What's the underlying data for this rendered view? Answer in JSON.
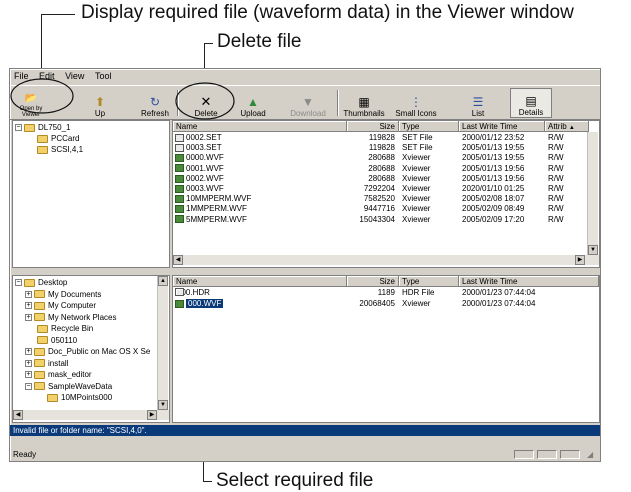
{
  "annotations": {
    "display": "Display required file (waveform data) in the Viewer window",
    "delete": "Delete file",
    "select": "Select required file"
  },
  "menu": [
    "File",
    "Edit",
    "View",
    "Tool"
  ],
  "toolbar": {
    "open_by_viewer": "Open by Viewer",
    "up": "Up",
    "refresh": "Refresh",
    "delete": "Delete",
    "upload": "Upload",
    "download": "Download",
    "thumbnails": "Thumbnails",
    "small_icons": "Small Icons",
    "list": "List",
    "details": "Details"
  },
  "top_tree": [
    {
      "label": "DL750_1",
      "expander": "−"
    },
    {
      "label": "PCCard"
    },
    {
      "label": "SCSI,4,1"
    }
  ],
  "top_columns": [
    "Name",
    "Size",
    "Type",
    "Last Write Time",
    "Attrib"
  ],
  "top_files": [
    {
      "name": "0002.SET",
      "size": "119828",
      "type": "SET File",
      "time": "2000/01/12 23:52",
      "attrib": "R/W",
      "icon": "set"
    },
    {
      "name": "0003.SET",
      "size": "119828",
      "type": "SET File",
      "time": "2005/01/13 19:55",
      "attrib": "R/W",
      "icon": "set"
    },
    {
      "name": "0000.WVF",
      "size": "280688",
      "type": "Xviewer",
      "time": "2005/01/13 19:55",
      "attrib": "R/W",
      "icon": "wvf"
    },
    {
      "name": "0001.WVF",
      "size": "280688",
      "type": "Xviewer",
      "time": "2005/01/13 19:56",
      "attrib": "R/W",
      "icon": "wvf"
    },
    {
      "name": "0002.WVF",
      "size": "280688",
      "type": "Xviewer",
      "time": "2005/01/13 19:56",
      "attrib": "R/W",
      "icon": "wvf"
    },
    {
      "name": "0003.WVF",
      "size": "7292204",
      "type": "Xviewer",
      "time": "2020/01/10 01:25",
      "attrib": "R/W",
      "icon": "wvf"
    },
    {
      "name": "10MMPERM.WVF",
      "size": "7582520",
      "type": "Xviewer",
      "time": "2005/02/08 18:07",
      "attrib": "R/W",
      "icon": "wvf"
    },
    {
      "name": "1MMPERM.WVF",
      "size": "9447716",
      "type": "Xviewer",
      "time": "2005/02/09 08:49",
      "attrib": "R/W",
      "icon": "wvf"
    },
    {
      "name": "5MMPERM.WVF",
      "size": "15043304",
      "type": "Xviewer",
      "time": "2005/02/09 17:20",
      "attrib": "R/W",
      "icon": "wvf"
    }
  ],
  "bottom_tree": [
    {
      "label": "Desktop",
      "expander": "−"
    },
    {
      "label": "My Documents",
      "expander": "+"
    },
    {
      "label": "My Computer",
      "expander": "+"
    },
    {
      "label": "My Network Places",
      "expander": "+"
    },
    {
      "label": "Recycle Bin",
      "expander": ""
    },
    {
      "label": "050110",
      "expander": ""
    },
    {
      "label": "Doc_Public on Mac OS X Se",
      "expander": "+"
    },
    {
      "label": "install",
      "expander": "+"
    },
    {
      "label": "mask_editor",
      "expander": "+"
    },
    {
      "label": "SampleWaveData",
      "expander": "−"
    },
    {
      "label": "10MPoints000",
      "expander": ""
    }
  ],
  "bottom_columns": [
    "Name",
    "Size",
    "Type",
    "Last Write Time"
  ],
  "bottom_files": [
    {
      "name": "000.HDR",
      "size": "1189",
      "type": "HDR File",
      "time": "2000/01/23 07:44:04",
      "icon": "hdr",
      "selected": false
    },
    {
      "name": "000.WVF",
      "size": "20068405",
      "type": "Xviewer",
      "time": "2000/01/23 07:44:04",
      "icon": "wvf",
      "selected": true
    }
  ],
  "status_message": "Invalid file or folder name: \"SCSI,4,0\".",
  "status_ready": "Ready",
  "colors": {
    "selection": "#0a3a7a",
    "window": "#d4d0c8"
  }
}
